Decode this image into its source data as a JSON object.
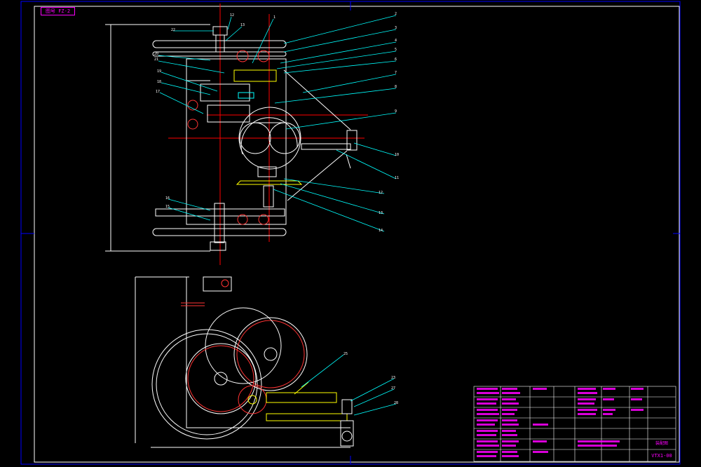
{
  "sheet": {
    "corner_tag": "图号 FZ-2",
    "drawing_code": "VTX1-00",
    "drawing_name": "装配图"
  },
  "colors": {
    "background": "#000000",
    "frame": "#0000ff",
    "outline": "#ffffff",
    "leader": "#00ffff",
    "centerline": "#ff0000",
    "red_part": "#ff3333",
    "yellow_part": "#ffff00",
    "magenta_text": "#ff00ff"
  },
  "callouts": {
    "top_view_left": [
      "22",
      "20",
      "21",
      "19",
      "18",
      "17"
    ],
    "top_view_top": [
      "12",
      "13"
    ],
    "top_view_right": [
      "1",
      "2",
      "3",
      "4",
      "5",
      "6",
      "7",
      "8",
      "9",
      "10",
      "11",
      "12",
      "13",
      "14"
    ],
    "top_view_bottom_left": [
      "16",
      "15"
    ],
    "side_view": [
      "25",
      "23",
      "27",
      "28"
    ]
  },
  "title_block": {
    "rows": 14,
    "note": "title block text too small to read"
  }
}
